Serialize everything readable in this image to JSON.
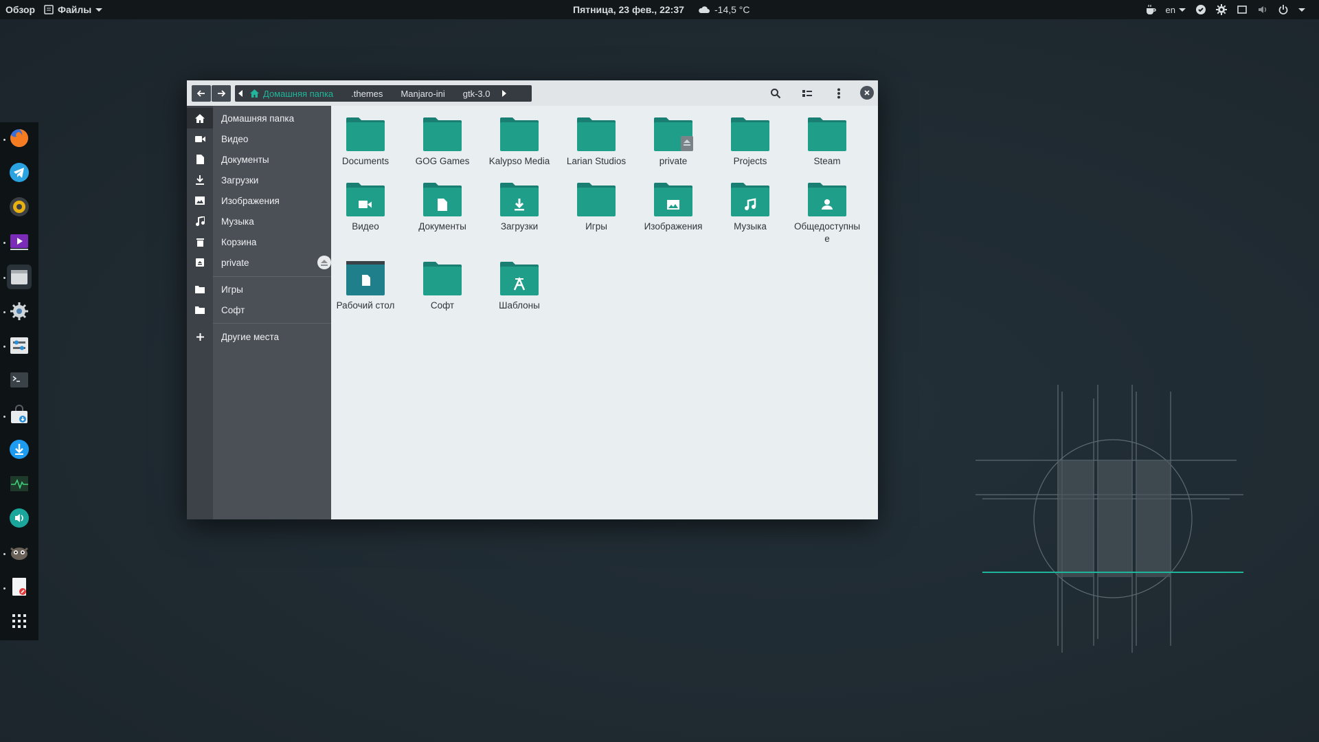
{
  "topbar": {
    "overview": "Обзор",
    "app_menu": "Файлы",
    "clock": "Пятница, 23 фев., 22:37",
    "weather": "-14,5 °C",
    "language": "en"
  },
  "dock": {
    "items": [
      {
        "name": "firefox",
        "running": true
      },
      {
        "name": "telegram",
        "running": false
      },
      {
        "name": "rhythmbox",
        "running": false
      },
      {
        "name": "videos",
        "running": true
      },
      {
        "name": "files",
        "running": true
      },
      {
        "name": "settings",
        "running": true
      },
      {
        "name": "tweaks",
        "running": true
      },
      {
        "name": "terminal",
        "running": false
      },
      {
        "name": "software",
        "running": true
      },
      {
        "name": "downloader",
        "running": false
      },
      {
        "name": "system-monitor",
        "running": false
      },
      {
        "name": "volume",
        "running": false
      },
      {
        "name": "gimp",
        "running": true
      },
      {
        "name": "text-editor",
        "running": true
      },
      {
        "name": "app-grid",
        "running": false
      }
    ]
  },
  "window": {
    "pathbar": [
      "Домашняя папка",
      ".themes",
      "Manjaro-ini",
      "gtk-3.0"
    ],
    "sidebar": {
      "places": [
        {
          "label": "Домашняя папка",
          "icon": "home-icon"
        },
        {
          "label": "Видео",
          "icon": "video-icon"
        },
        {
          "label": "Документы",
          "icon": "document-icon"
        },
        {
          "label": "Загрузки",
          "icon": "download-icon"
        },
        {
          "label": "Изображения",
          "icon": "image-icon"
        },
        {
          "label": "Музыка",
          "icon": "music-icon"
        },
        {
          "label": "Корзина",
          "icon": "trash-icon"
        },
        {
          "label": "private",
          "icon": "drive-icon"
        }
      ],
      "bookmarks": [
        {
          "label": "Игры",
          "icon": "folder-icon"
        },
        {
          "label": "Софт",
          "icon": "folder-icon"
        }
      ],
      "other": "Другие места"
    },
    "files": [
      {
        "name": "Documents",
        "emblem": ""
      },
      {
        "name": "GOG Games",
        "emblem": ""
      },
      {
        "name": "Kalypso Media",
        "emblem": ""
      },
      {
        "name": "Larian Studios",
        "emblem": ""
      },
      {
        "name": "private",
        "emblem": "eject"
      },
      {
        "name": "Projects",
        "emblem": ""
      },
      {
        "name": "Steam",
        "emblem": ""
      },
      {
        "name": "Видео",
        "emblem": "video"
      },
      {
        "name": "Документы",
        "emblem": "document"
      },
      {
        "name": "Загрузки",
        "emblem": "download"
      },
      {
        "name": "Игры",
        "emblem": ""
      },
      {
        "name": "Изображения",
        "emblem": "image"
      },
      {
        "name": "Музыка",
        "emblem": "music"
      },
      {
        "name": "Общедоступные",
        "emblem": "user"
      },
      {
        "name": "Рабочий стол",
        "emblem": "desktop"
      },
      {
        "name": "Софт",
        "emblem": ""
      },
      {
        "name": "Шаблоны",
        "emblem": "template"
      }
    ]
  },
  "colors": {
    "accent": "#21b59b",
    "folder": "#1f9e8a",
    "folder_tab": "#197f73",
    "sidebar": "#4b5057"
  }
}
